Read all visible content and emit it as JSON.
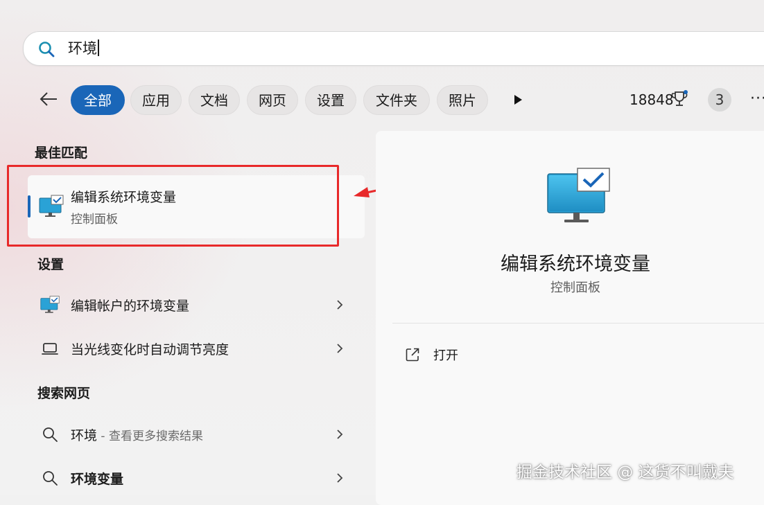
{
  "search": {
    "query": "环境"
  },
  "filters": {
    "chips": [
      "全部",
      "应用",
      "文档",
      "网页",
      "设置",
      "文件夹",
      "照片"
    ],
    "active_index": 0,
    "points": "18848",
    "avatar_initial": "3"
  },
  "best_match": {
    "section_title": "最佳匹配",
    "title": "编辑系统环境变量",
    "subtitle": "控制面板",
    "icon": "monitor-checkmark-icon"
  },
  "settings": {
    "section_title": "设置",
    "items": [
      {
        "label": "编辑帐户的环境变量",
        "icon": "monitor-checkmark-icon"
      },
      {
        "label": "当光线变化时自动调节亮度",
        "icon": "laptop-icon"
      }
    ]
  },
  "web": {
    "section_title": "搜索网页",
    "items": [
      {
        "label": "环境",
        "suffix": " - 查看更多搜索结果",
        "icon": "search-icon"
      },
      {
        "label": "环境变量",
        "icon": "search-icon"
      }
    ]
  },
  "details": {
    "title": "编辑系统环境变量",
    "subtitle": "控制面板",
    "open_label": "打开"
  },
  "watermark": "掘金技术社区 @ 这货不叫戴夫",
  "colors": {
    "accent": "#1a66b8",
    "annotation_red": "#e8292a"
  }
}
